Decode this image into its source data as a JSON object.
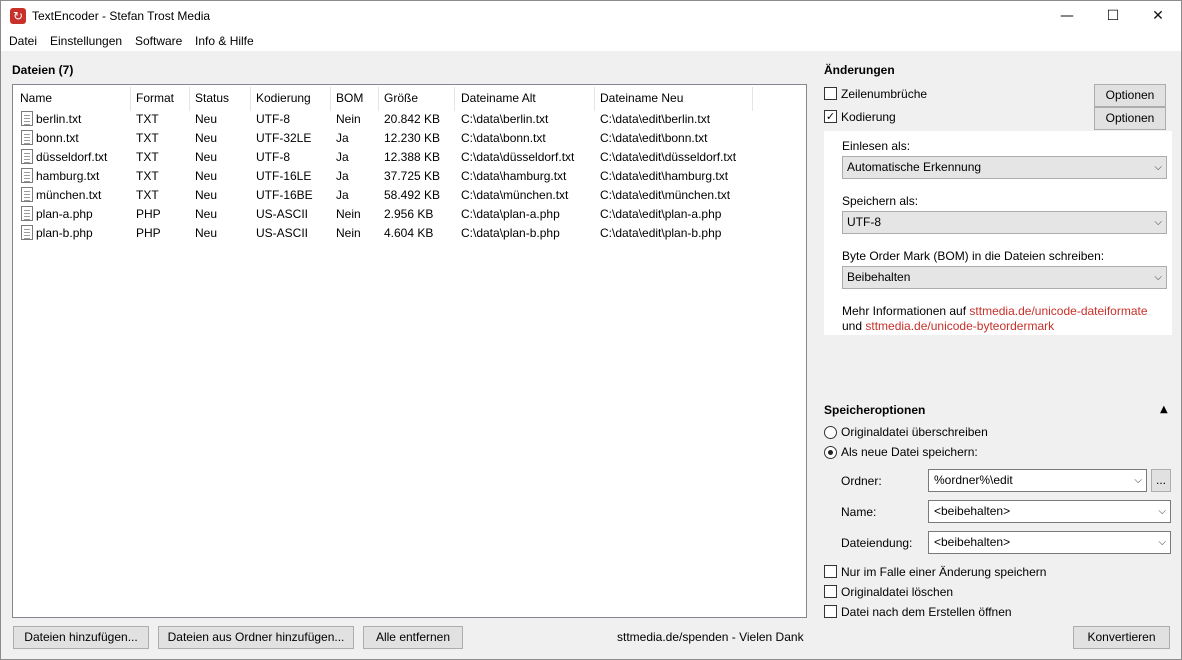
{
  "window": {
    "title": "TextEncoder - Stefan Trost Media",
    "app_icon": "↻",
    "controls": {
      "minimize": "—",
      "maximize": "☐",
      "close": "✕"
    }
  },
  "menu": [
    "Datei",
    "Einstellungen",
    "Software",
    "Info & Hilfe"
  ],
  "files": {
    "heading": "Dateien (7)",
    "columns": [
      "Name",
      "Format",
      "Status",
      "Kodierung",
      "BOM",
      "Größe",
      "Dateiname Alt",
      "Dateiname Neu"
    ],
    "rows": [
      [
        "berlin.txt",
        "TXT",
        "Neu",
        "UTF-8",
        "Nein",
        "20.842 KB",
        "C:\\data\\berlin.txt",
        "C:\\data\\edit\\berlin.txt"
      ],
      [
        "bonn.txt",
        "TXT",
        "Neu",
        "UTF-32LE",
        "Ja",
        "12.230 KB",
        "C:\\data\\bonn.txt",
        "C:\\data\\edit\\bonn.txt"
      ],
      [
        "düsseldorf.txt",
        "TXT",
        "Neu",
        "UTF-8",
        "Ja",
        "12.388 KB",
        "C:\\data\\düsseldorf.txt",
        "C:\\data\\edit\\düsseldorf.txt"
      ],
      [
        "hamburg.txt",
        "TXT",
        "Neu",
        "UTF-16LE",
        "Ja",
        "37.725 KB",
        "C:\\data\\hamburg.txt",
        "C:\\data\\edit\\hamburg.txt"
      ],
      [
        "münchen.txt",
        "TXT",
        "Neu",
        "UTF-16BE",
        "Ja",
        "58.492 KB",
        "C:\\data\\münchen.txt",
        "C:\\data\\edit\\münchen.txt"
      ],
      [
        "plan-a.php",
        "PHP",
        "Neu",
        "US-ASCII",
        "Nein",
        "2.956 KB",
        "C:\\data\\plan-a.php",
        "C:\\data\\edit\\plan-a.php"
      ],
      [
        "plan-b.php",
        "PHP",
        "Neu",
        "US-ASCII",
        "Nein",
        "4.604 KB",
        "C:\\data\\plan-b.php",
        "C:\\data\\edit\\plan-b.php"
      ]
    ]
  },
  "bottom": {
    "add_files": "Dateien hinzufügen...",
    "add_folder": "Dateien aus Ordner hinzufügen...",
    "remove_all": "Alle entfernen",
    "donate": "sttmedia.de/spenden - Vielen Dank",
    "convert": "Konvertieren"
  },
  "changes": {
    "heading": "Änderungen",
    "line_breaks": {
      "label": "Zeilenumbrüche",
      "checked": false,
      "options": "Optionen"
    },
    "encoding": {
      "label": "Kodierung",
      "checked": true,
      "options": "Optionen"
    },
    "read_as_label": "Einlesen als:",
    "read_as_value": "Automatische Erkennung",
    "save_as_label": "Speichern als:",
    "save_as_value": "UTF-8",
    "bom_label": "Byte Order Mark (BOM) in die Dateien schreiben:",
    "bom_value": "Beibehalten",
    "info_prefix": "Mehr Informationen auf",
    "info_link1": "sttmedia.de/unicode-dateiformate",
    "info_and": "und",
    "info_link2": "sttmedia.de/unicode-byteordermark",
    "check_mark": "✓"
  },
  "save_options": {
    "heading": "Speicheroptionen",
    "collapse_icon": "▲",
    "overwrite": "Originaldatei überschreiben",
    "save_new": "Als neue Datei speichern:",
    "selected": "save_new",
    "folder_label": "Ordner:",
    "folder_value": "%ordner%\\edit",
    "browse": "...",
    "name_label": "Name:",
    "name_value": "<beibehalten>",
    "ext_label": "Dateiendung:",
    "ext_value": "<beibehalten>",
    "only_on_change": "Nur im Falle einer Änderung speichern",
    "delete_original": "Originaldatei löschen",
    "open_after": "Datei nach dem Erstellen öffnen",
    "chevron": "⌵"
  }
}
